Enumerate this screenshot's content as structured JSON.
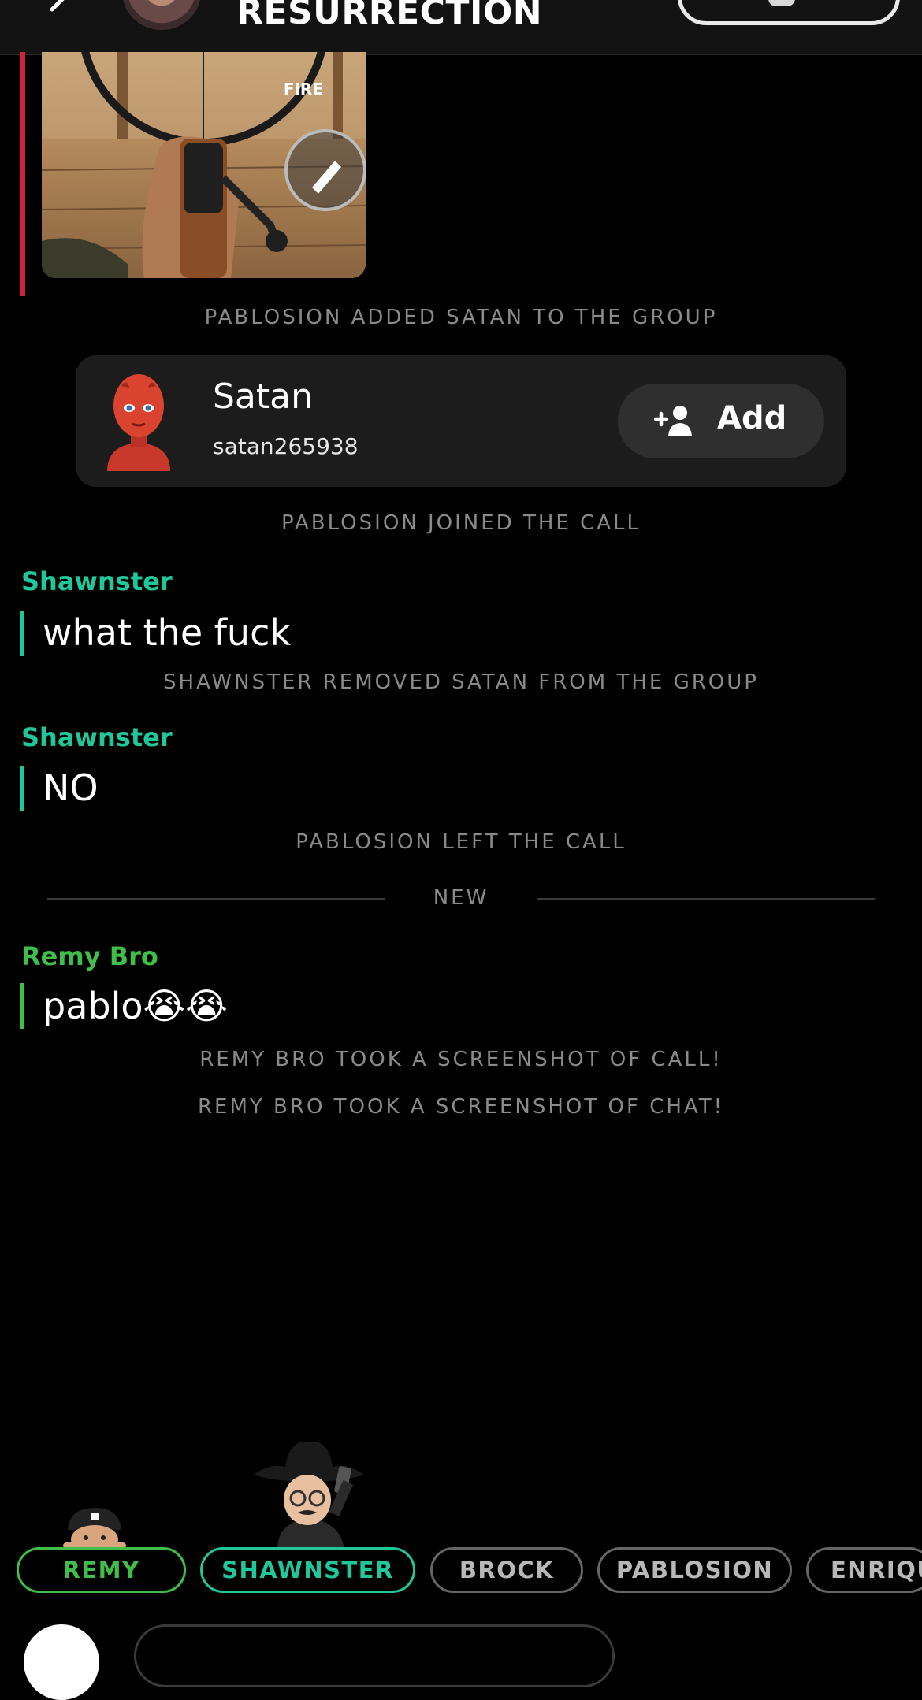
{
  "header": {
    "title": "RESURRECTION"
  },
  "media": {
    "fire_label": "FIRE"
  },
  "system_messages": {
    "added": "PABLOSION ADDED SATAN TO THE GROUP",
    "joined": "PABLOSION JOINED THE CALL",
    "removed": "SHAWNSTER REMOVED SATAN FROM THE GROUP",
    "left": "PABLOSION LEFT THE CALL",
    "new_divider": "NEW",
    "screenshot_call": "REMY BRO TOOK A SCREENSHOT OF CALL!",
    "screenshot_chat": "REMY BRO TOOK A SCREENSHOT OF CHAT!"
  },
  "friend_card": {
    "name": "Satan",
    "username": "satan265938",
    "add_label": "Add"
  },
  "messages": [
    {
      "sender": "Shawnster",
      "text": "what the fuck"
    },
    {
      "sender": "Shawnster",
      "text": "NO"
    },
    {
      "sender": "Remy Bro",
      "text": "pablo😭😭"
    }
  ],
  "participants": [
    "REMY",
    "SHAWNSTER",
    "BROCK",
    "PABLOSION",
    "ENRIQU"
  ],
  "colors": {
    "shawnster": "#1fc79a",
    "remy": "#3fbf4a",
    "media_bar": "#d0203a",
    "system_text": "#8a8a8a"
  }
}
